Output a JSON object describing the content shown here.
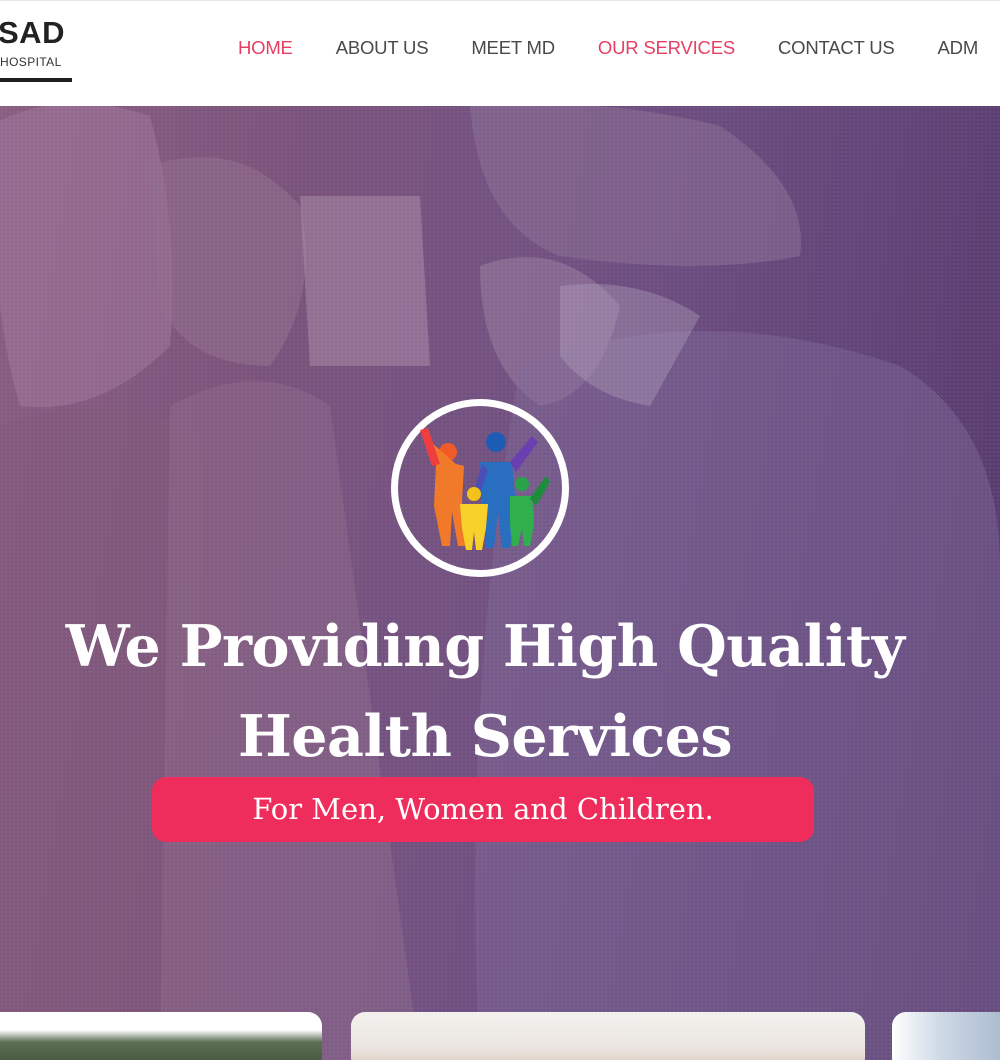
{
  "logo": {
    "name": "SAD",
    "subtitle": "HOSPITAL"
  },
  "nav": {
    "items": [
      {
        "label": "HOME",
        "active": true
      },
      {
        "label": "ABOUT US",
        "active": false
      },
      {
        "label": "MEET MD",
        "active": false
      },
      {
        "label": "OUR SERVICES",
        "active": true
      },
      {
        "label": "CONTACT US",
        "active": false
      },
      {
        "label": "ADM",
        "active": false
      }
    ]
  },
  "hero": {
    "headline": "We Providing High Quality Health Services",
    "tagline": "For Men, Women and Children.",
    "icon": "family-logo-icon"
  },
  "colors": {
    "accent": "#e83e62",
    "tagline_bg": "#ef2d5c",
    "hero_overlay": "#7e5c8f",
    "nav_text": "#4a4a4a"
  }
}
